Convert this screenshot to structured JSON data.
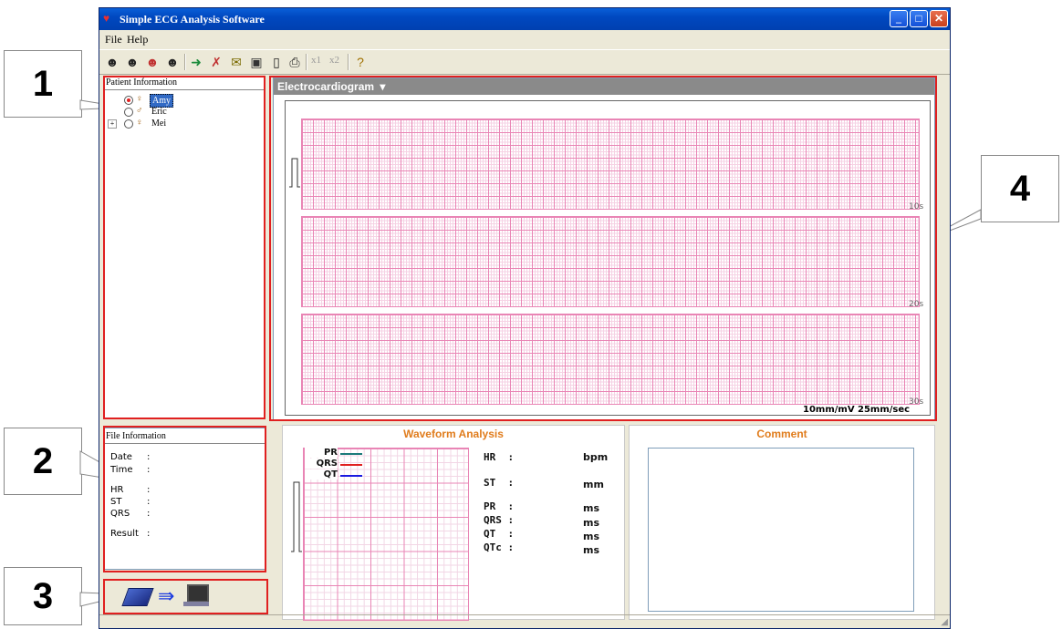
{
  "window": {
    "title": "Simple ECG Analysis Software"
  },
  "menu": [
    "File",
    "Help"
  ],
  "toolbar": {
    "icons": [
      "patient-add-icon",
      "patient-edit-icon",
      "patient-delete-icon",
      "patient-search-icon",
      "import-arrow-icon",
      "delete-record-icon",
      "mail-icon",
      "save-icon",
      "print-preview-icon",
      "print-icon"
    ],
    "x1": "x1",
    "x2": "x2",
    "help_icon": "help-icon"
  },
  "callouts": [
    "1",
    "2",
    "3",
    "4"
  ],
  "patient_panel": {
    "title": "Patient Information",
    "patients": [
      {
        "name": "Amy",
        "selected": true,
        "expandable": false
      },
      {
        "name": "Eric",
        "selected": false,
        "expandable": false
      },
      {
        "name": "Mei",
        "selected": false,
        "expandable": true
      }
    ],
    "expand_glyph": "+"
  },
  "file_panel": {
    "title": "File Information",
    "fields": [
      {
        "label": "Date",
        "sep": ":"
      },
      {
        "label": "Time",
        "sep": ":"
      },
      {
        "label": "HR",
        "sep": ":"
      },
      {
        "label": "ST",
        "sep": ":"
      },
      {
        "label": "QRS",
        "sep": ":"
      },
      {
        "label": "Result",
        "sep": ":"
      }
    ]
  },
  "transfer": {
    "icons": [
      "device-icon",
      "arrow-right-icon",
      "computer-icon"
    ]
  },
  "ecg": {
    "header": "Electrocardiogram",
    "dropdown_glyph": "▾",
    "strips": [
      "10s",
      "20s",
      "30s"
    ],
    "gain": "10mm/mV",
    "speed": "25mm/sec"
  },
  "waveform": {
    "title": "Waveform Analysis",
    "legend": [
      {
        "name": "PR",
        "color": "#1a7a7a"
      },
      {
        "name": "QRS",
        "color": "#e02020"
      },
      {
        "name": "QT",
        "color": "#1a1ae0"
      }
    ],
    "measurements": [
      {
        "label": "HR  :",
        "unit": "bpm"
      },
      {
        "label": "ST  :",
        "unit": "mm"
      },
      {
        "label": "PR  :",
        "unit": "ms"
      },
      {
        "label": "QRS :",
        "unit": "ms"
      },
      {
        "label": "QT  :",
        "unit": "ms"
      },
      {
        "label": "QTc :",
        "unit": "ms"
      }
    ]
  },
  "comment": {
    "title": "Comment"
  },
  "colors": {
    "title_bar": "#0048c0",
    "highlight_border": "#e02020",
    "section_title": "#e07c1c",
    "grid": "#e985b5"
  }
}
